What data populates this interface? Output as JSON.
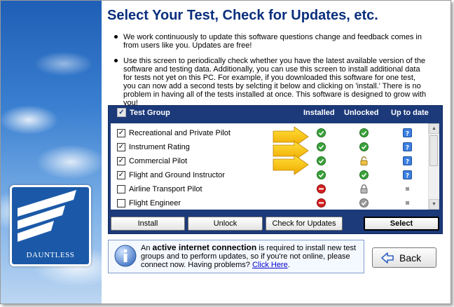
{
  "title": "Select Your Test, Check for Updates, etc.",
  "intro": [
    "We work continuously to update this software questions change and feedback comes in from users like you.  Updates are free!",
    "Use this screen to periodically check whether you have the latest available version of the software and testing data.  Additionally, you can use this screen to install additional data for tests not yet on this PC.  For example, if you downloaded this software for one test, you can now add a second tests by selcting it below and clicking on 'install.'  There is no problem in having all of the tests installed at once.  This software is designed to grow with you!"
  ],
  "table": {
    "headers": {
      "group": "Test Group",
      "installed": "Installed",
      "unlocked": "Unlocked",
      "up_to_date": "Up to date"
    },
    "header_checked": true,
    "rows": [
      {
        "name": "Recreational and Private Pilot",
        "checked": true,
        "installed": "check",
        "unlocked": "check",
        "up_to_date": "info"
      },
      {
        "name": "Instrument Rating",
        "checked": true,
        "installed": "check",
        "unlocked": "check",
        "up_to_date": "info"
      },
      {
        "name": "Commercial Pilot",
        "checked": true,
        "installed": "check",
        "unlocked": "lock-open",
        "up_to_date": "info"
      },
      {
        "name": "Flight and Ground Instructor",
        "checked": true,
        "installed": "check",
        "unlocked": "check",
        "up_to_date": "info"
      },
      {
        "name": "Airline Transport Pilot",
        "checked": false,
        "installed": "blocked",
        "unlocked": "lock-closed",
        "up_to_date": "square"
      },
      {
        "name": "Flight Engineer",
        "checked": false,
        "installed": "blocked",
        "unlocked": "check-gray",
        "up_to_date": "square"
      }
    ]
  },
  "buttons": {
    "install": "Install",
    "unlock": "Unlock",
    "check_updates": "Check for Updates",
    "select": "Select",
    "back": "Back"
  },
  "info": {
    "prefix": "An ",
    "bold": "active internet connection",
    "rest": " is required to install new test groups and to perform updates, so if you're not online, please connect now.  Having problems? ",
    "link": "Click Here",
    "suffix": "."
  },
  "logo": {
    "text": "DAUNTLESS"
  },
  "colors": {
    "title": "#0a2f7d",
    "panel": "#1c3a7a",
    "check_green": "#3aa33a",
    "blocked_red": "#d42020",
    "info_blue": "#3b7fe0",
    "arrow_yellow": "#f5c400"
  }
}
